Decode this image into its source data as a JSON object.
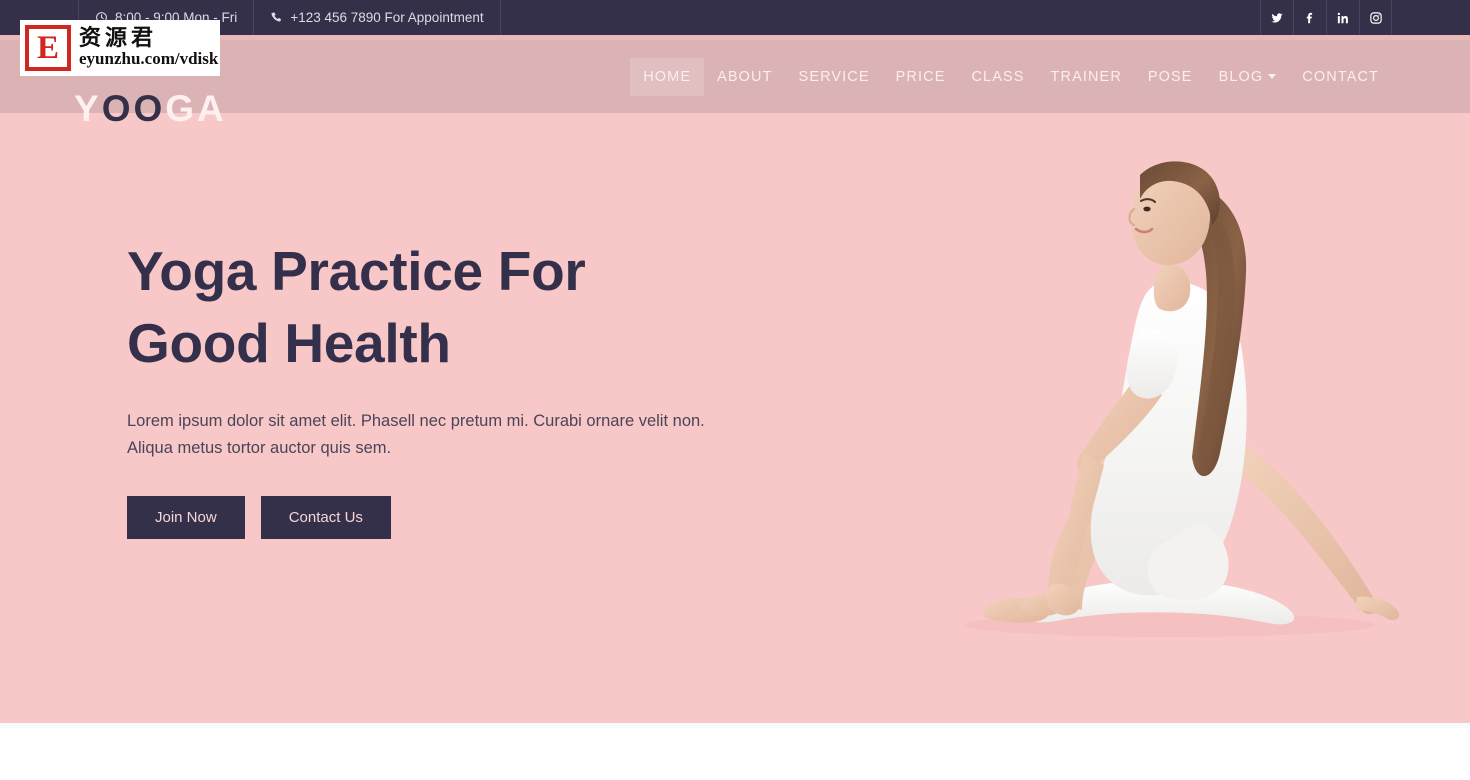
{
  "topbar": {
    "hours": "8:00 - 9:00 Mon - Fri",
    "phone": "+123 456 7890 For Appointment",
    "hours_icon": "clock-icon",
    "phone_icon": "phone-icon",
    "social": [
      {
        "name": "twitter-icon",
        "label": "Twitter"
      },
      {
        "name": "facebook-icon",
        "label": "Facebook"
      },
      {
        "name": "linkedin-icon",
        "label": "LinkedIn"
      },
      {
        "name": "instagram-icon",
        "label": "Instagram"
      }
    ],
    "background_color": "#353049"
  },
  "header": {
    "logo_part1": "Y",
    "logo_part2": "OO",
    "logo_part3": "GA",
    "logo_full": "YOOGA",
    "background_color": "#dcb3b5",
    "nav": [
      {
        "label": "HOME",
        "active": true,
        "dropdown": false
      },
      {
        "label": "ABOUT",
        "active": false,
        "dropdown": false
      },
      {
        "label": "SERVICE",
        "active": false,
        "dropdown": false
      },
      {
        "label": "PRICE",
        "active": false,
        "dropdown": false
      },
      {
        "label": "CLASS",
        "active": false,
        "dropdown": false
      },
      {
        "label": "TRAINER",
        "active": false,
        "dropdown": false
      },
      {
        "label": "POSE",
        "active": false,
        "dropdown": false
      },
      {
        "label": "BLOG",
        "active": false,
        "dropdown": true
      },
      {
        "label": "CONTACT",
        "active": false,
        "dropdown": false
      }
    ]
  },
  "hero": {
    "title_line1": "Yoga Practice For",
    "title_line2": "Good Health",
    "subtitle": "Lorem ipsum dolor sit amet elit. Phasell nec pretum mi. Curabi ornare velit non. Aliqua metus tortor auctor quis sem.",
    "primary_button": "Join Now",
    "secondary_button": "Contact Us",
    "background_color": "#f8c8c8",
    "heading_color": "#34304c",
    "button_color": "#353049",
    "image_alt": "woman-seated-spinal-twist-yoga-pose"
  },
  "watermark": {
    "badge_letter": "E",
    "chinese": "资源君",
    "url": "eyunzhu.com/vdisk",
    "badge_color": "#d2251f"
  }
}
